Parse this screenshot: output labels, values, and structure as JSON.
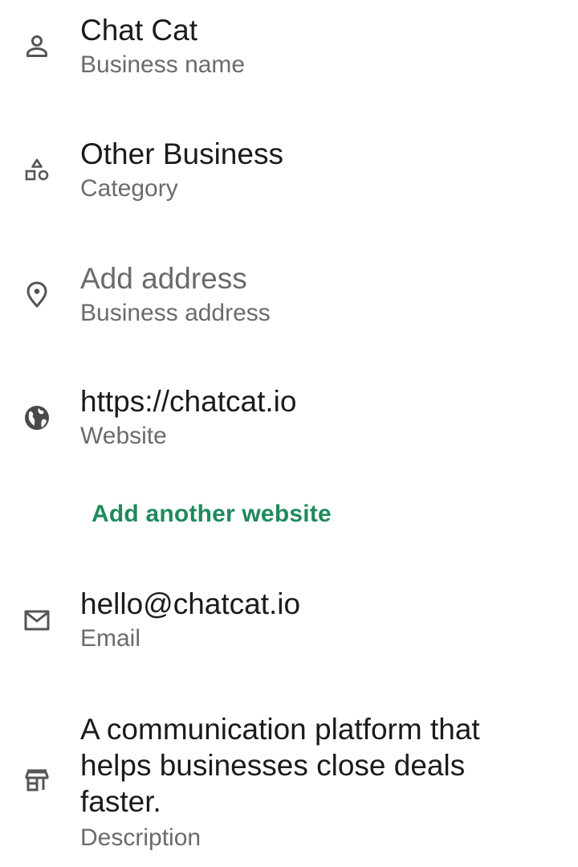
{
  "business_name": {
    "value": "Chat Cat",
    "label": "Business name",
    "icon": "person-icon"
  },
  "category": {
    "value": "Other Business",
    "label": "Category",
    "icon": "category-shapes-icon"
  },
  "address": {
    "placeholder": "Add address",
    "label": "Business address",
    "icon": "location-pin-icon"
  },
  "website": {
    "value": "https://chatcat.io",
    "label": "Website",
    "icon": "globe-icon",
    "add_another_label": "Add another website",
    "accent_color": "#1f8a5c"
  },
  "email": {
    "value": "hello@chatcat.io",
    "label": "Email",
    "icon": "envelope-icon"
  },
  "description": {
    "value": "A communication platform that helps businesses close deals faster.",
    "label": "Description",
    "icon": "storefront-icon"
  }
}
